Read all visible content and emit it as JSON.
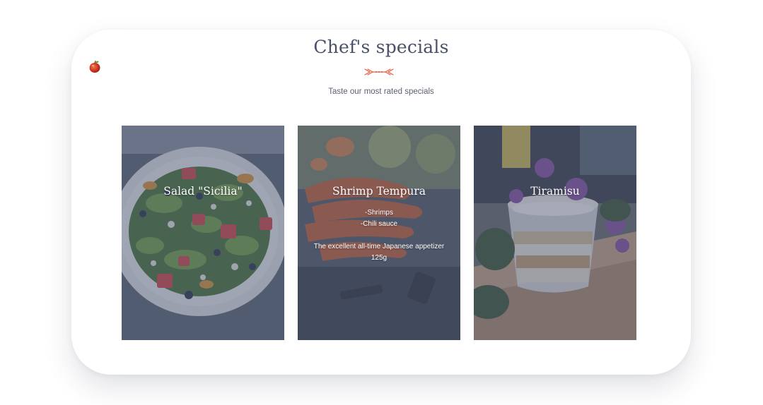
{
  "section": {
    "title": "Chef's specials",
    "subtitle": "Taste our most rated specials"
  },
  "icons": {
    "divider": "arrow-ornament-icon",
    "decor": "apple-icon"
  },
  "colors": {
    "accent": "#e8573f",
    "title_text": "#4a5167",
    "card_overlay": "#464e68"
  },
  "cards": [
    {
      "title": "Salad \"Sicilia\"",
      "lines": []
    },
    {
      "title": "Shrimp Tempura",
      "lines": [
        "-Shrimps",
        "-Chili sauce"
      ],
      "description": "The excellent all-time Japanese appetizer",
      "weight": "125g"
    },
    {
      "title": "Tiramisu",
      "lines": []
    }
  ]
}
